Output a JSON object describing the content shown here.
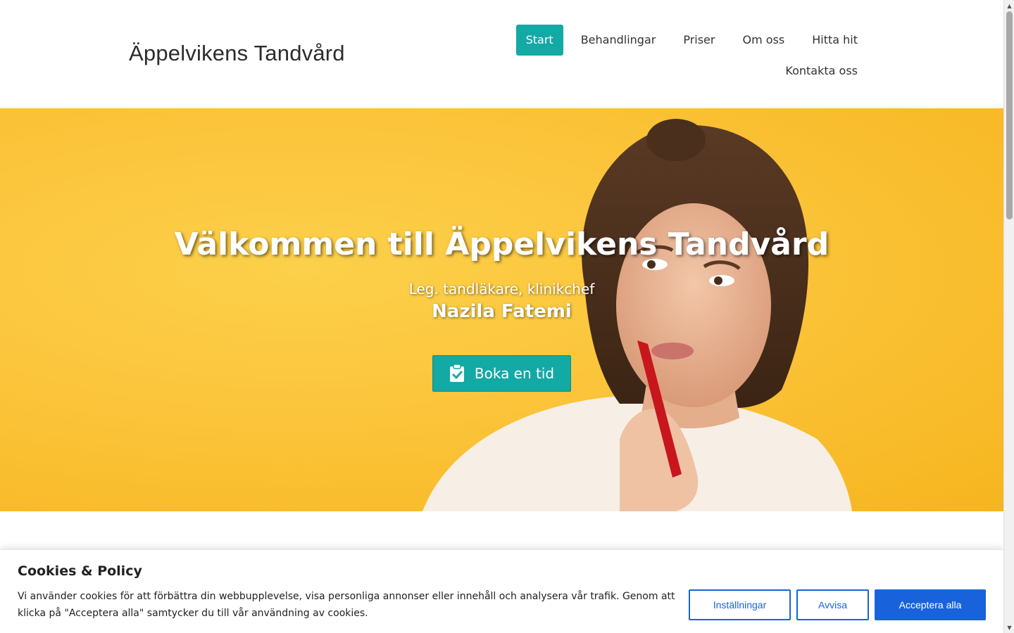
{
  "header": {
    "site_title": "Äppelvikens Tandvård",
    "nav": [
      {
        "label": "Start",
        "active": true
      },
      {
        "label": "Behandlingar",
        "active": false
      },
      {
        "label": "Priser",
        "active": false
      },
      {
        "label": "Om oss",
        "active": false
      },
      {
        "label": "Hitta hit",
        "active": false
      },
      {
        "label": "Kontakta oss",
        "active": false
      }
    ]
  },
  "hero": {
    "title": "Välkommen till Äppelvikens Tandvård",
    "subtitle": "Leg. tandläkare, klinikchef",
    "name": "Nazila Fatemi",
    "book_button": {
      "label": "Boka en tid",
      "icon": "clipboard-check-icon"
    }
  },
  "cookie_banner": {
    "title": "Cookies & Policy",
    "text": "Vi använder cookies för att förbättra din webbupplevelse, visa personliga annonser eller innehåll och analysera vår trafik. Genom att klicka på \"Acceptera alla\" samtycker du till vår användning av cookies.",
    "settings_label": "Inställningar",
    "reject_label": "Avvisa",
    "accept_label": "Acceptera alla"
  },
  "colors": {
    "accent": "#13a9a5",
    "hero_background": "#fbc43a",
    "cookie_primary": "#1863dc"
  }
}
